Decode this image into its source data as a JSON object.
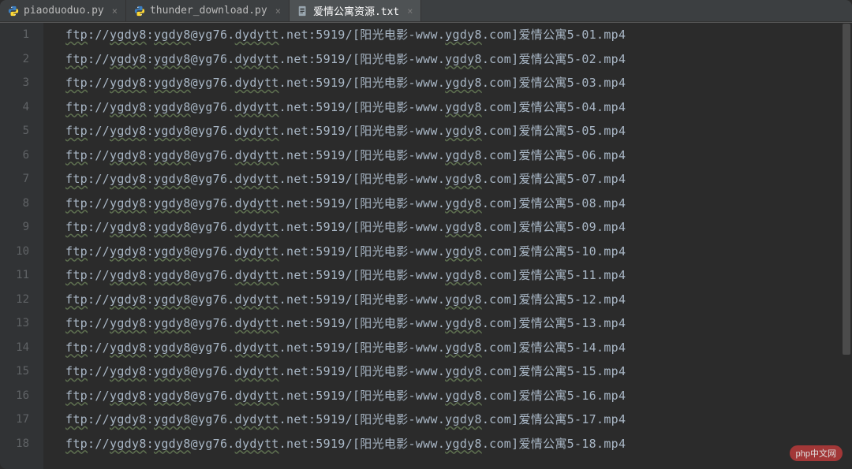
{
  "tabs": [
    {
      "label": "piaoduoduo.py",
      "icon": "python",
      "active": false
    },
    {
      "label": "thunder_download.py",
      "icon": "python",
      "active": false
    },
    {
      "label": "爱情公寓资源.txt",
      "icon": "text",
      "active": true
    }
  ],
  "lines": [
    {
      "num": "1",
      "text": "ftp://ygdy8:ygdy8@yg76.dydytt.net:5919/[阳光电影-www.ygdy8.com]爱情公寓5-01.mp4"
    },
    {
      "num": "2",
      "text": "ftp://ygdy8:ygdy8@yg76.dydytt.net:5919/[阳光电影-www.ygdy8.com]爱情公寓5-02.mp4"
    },
    {
      "num": "3",
      "text": "ftp://ygdy8:ygdy8@yg76.dydytt.net:5919/[阳光电影-www.ygdy8.com]爱情公寓5-03.mp4"
    },
    {
      "num": "4",
      "text": "ftp://ygdy8:ygdy8@yg76.dydytt.net:5919/[阳光电影-www.ygdy8.com]爱情公寓5-04.mp4"
    },
    {
      "num": "5",
      "text": "ftp://ygdy8:ygdy8@yg76.dydytt.net:5919/[阳光电影-www.ygdy8.com]爱情公寓5-05.mp4"
    },
    {
      "num": "6",
      "text": "ftp://ygdy8:ygdy8@yg76.dydytt.net:5919/[阳光电影-www.ygdy8.com]爱情公寓5-06.mp4"
    },
    {
      "num": "7",
      "text": "ftp://ygdy8:ygdy8@yg76.dydytt.net:5919/[阳光电影-www.ygdy8.com]爱情公寓5-07.mp4"
    },
    {
      "num": "8",
      "text": "ftp://ygdy8:ygdy8@yg76.dydytt.net:5919/[阳光电影-www.ygdy8.com]爱情公寓5-08.mp4"
    },
    {
      "num": "9",
      "text": "ftp://ygdy8:ygdy8@yg76.dydytt.net:5919/[阳光电影-www.ygdy8.com]爱情公寓5-09.mp4"
    },
    {
      "num": "10",
      "text": "ftp://ygdy8:ygdy8@yg76.dydytt.net:5919/[阳光电影-www.ygdy8.com]爱情公寓5-10.mp4"
    },
    {
      "num": "11",
      "text": "ftp://ygdy8:ygdy8@yg76.dydytt.net:5919/[阳光电影-www.ygdy8.com]爱情公寓5-11.mp4"
    },
    {
      "num": "12",
      "text": "ftp://ygdy8:ygdy8@yg76.dydytt.net:5919/[阳光电影-www.ygdy8.com]爱情公寓5-12.mp4"
    },
    {
      "num": "13",
      "text": "ftp://ygdy8:ygdy8@yg76.dydytt.net:5919/[阳光电影-www.ygdy8.com]爱情公寓5-13.mp4"
    },
    {
      "num": "14",
      "text": "ftp://ygdy8:ygdy8@yg76.dydytt.net:5919/[阳光电影-www.ygdy8.com]爱情公寓5-14.mp4"
    },
    {
      "num": "15",
      "text": "ftp://ygdy8:ygdy8@yg76.dydytt.net:5919/[阳光电影-www.ygdy8.com]爱情公寓5-15.mp4"
    },
    {
      "num": "16",
      "text": "ftp://ygdy8:ygdy8@yg76.dydytt.net:5919/[阳光电影-www.ygdy8.com]爱情公寓5-16.mp4"
    },
    {
      "num": "17",
      "text": "ftp://ygdy8:ygdy8@yg76.dydytt.net:5919/[阳光电影-www.ygdy8.com]爱情公寓5-17.mp4"
    },
    {
      "num": "18",
      "text": "ftp://ygdy8:ygdy8@yg76.dydytt.net:5919/[阳光电影-www.ygdy8.com]爱情公寓5-18.mp4"
    }
  ],
  "watermark": "php中文网"
}
